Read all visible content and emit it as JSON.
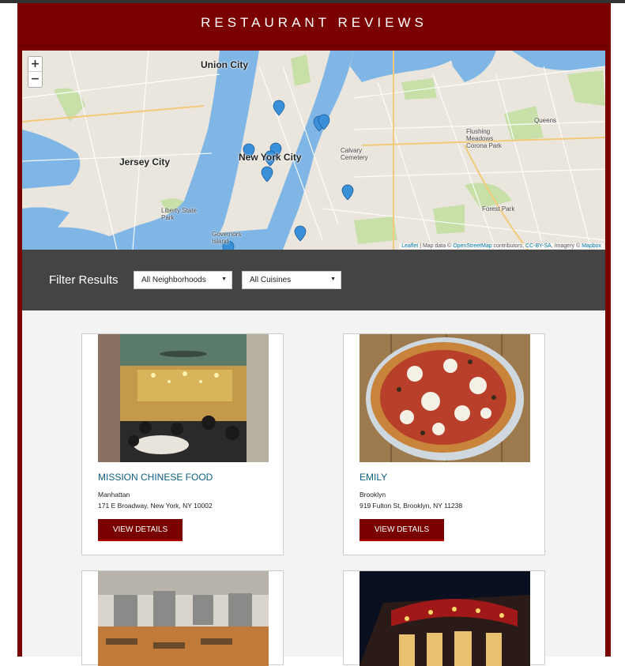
{
  "header": {
    "title": "RESTAURANT REVIEWS"
  },
  "map": {
    "zoom_in": "+",
    "zoom_out": "−",
    "labels": {
      "union_city": "Union City",
      "jersey_city": "Jersey City",
      "new_york_city": "New York City",
      "liberty_state_park": "Liberty State Park",
      "queens": "Queens",
      "flushing_meadows": "Flushing Meadows Corona Park",
      "forest_park": "Forest Park",
      "calvary_cemetery": "Calvary Cemetery",
      "governors_island": "Governors Island"
    },
    "attribution": {
      "leaflet": "Leaflet",
      "map_data": " | Map data © ",
      "osm": "OpenStreetMap",
      "contributors": " contributors, ",
      "license": "CC-BY-SA",
      "imagery": ", Imagery © ",
      "mapbox": "Mapbox"
    },
    "colors": {
      "water": "#7fb6e6",
      "land": "#eae6dd",
      "park": "#c8dfa8",
      "marker": "#3a8fd9"
    }
  },
  "filter": {
    "label": "Filter Results",
    "neighborhood_selected": "All Neighborhoods",
    "cuisine_selected": "All Cuisines"
  },
  "restaurants": [
    {
      "name": "Mission Chinese Food",
      "neighborhood": "Manhattan",
      "address": "171 E Broadway, New York, NY 10002",
      "button": "VIEW DETAILS"
    },
    {
      "name": "Emily",
      "neighborhood": "Brooklyn",
      "address": "919 Fulton St, Brooklyn, NY 11238",
      "button": "VIEW DETAILS"
    },
    {
      "name": "",
      "neighborhood": "",
      "address": "",
      "button": ""
    },
    {
      "name": "",
      "neighborhood": "",
      "address": "",
      "button": ""
    }
  ]
}
